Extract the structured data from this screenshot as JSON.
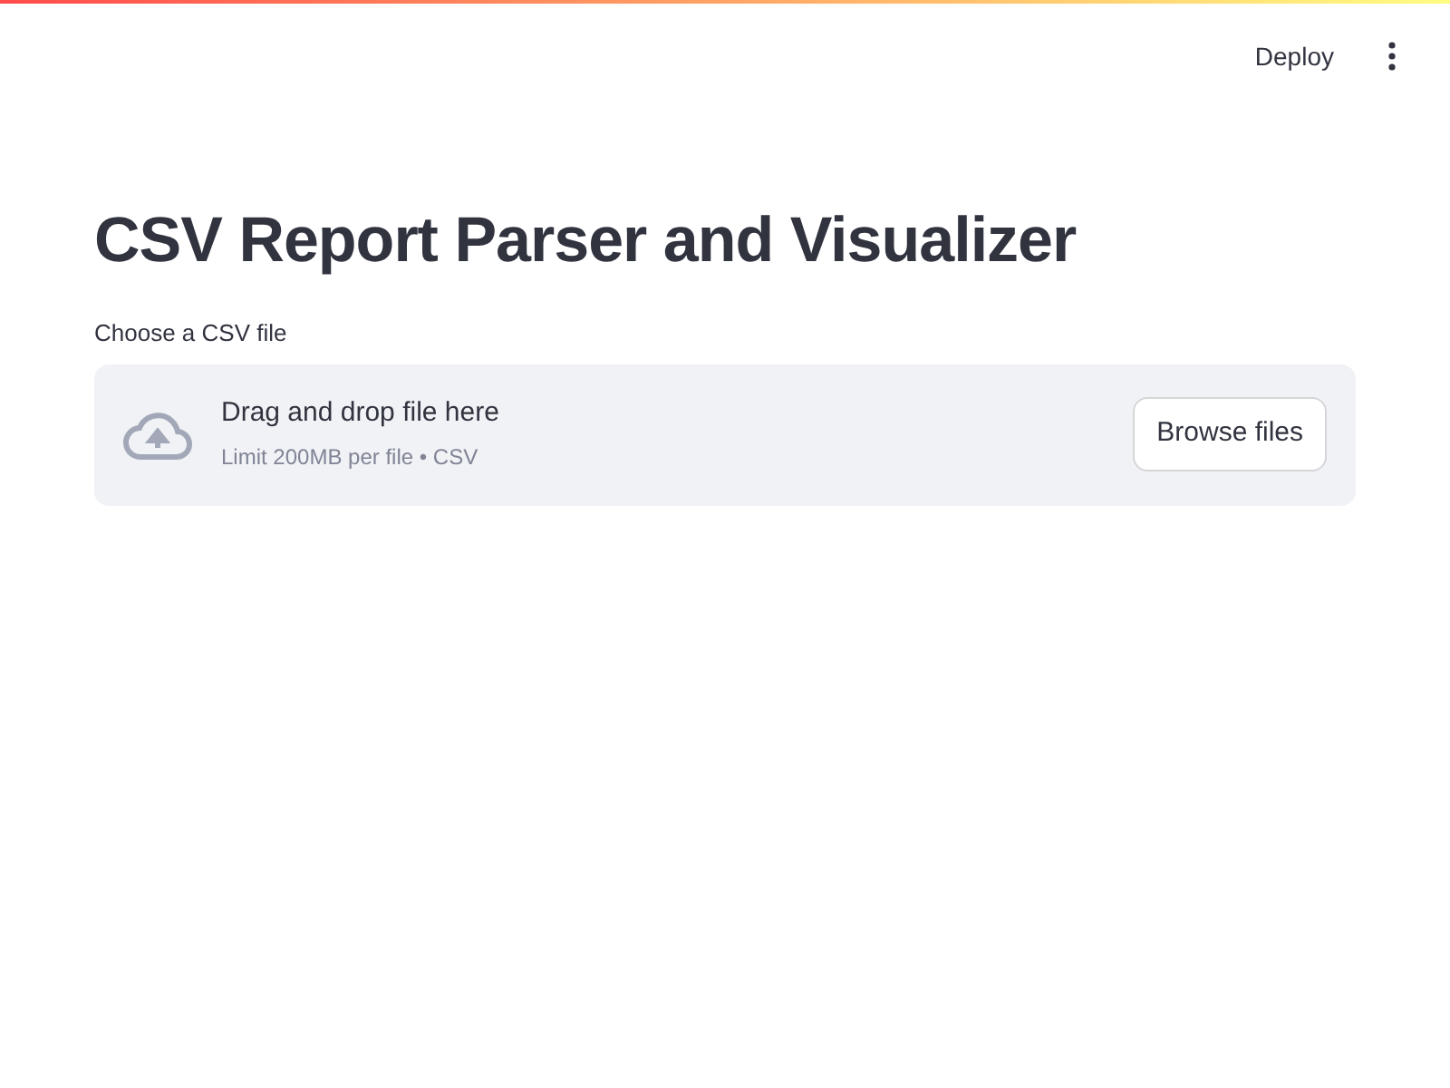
{
  "header": {
    "deploy": "Deploy"
  },
  "title": "CSV Report Parser and Visualizer",
  "uploader": {
    "label": "Choose a CSV file",
    "drop_text": "Drag and drop file here",
    "limit_text": "Limit 200MB per file • CSV",
    "button": "Browse files"
  }
}
